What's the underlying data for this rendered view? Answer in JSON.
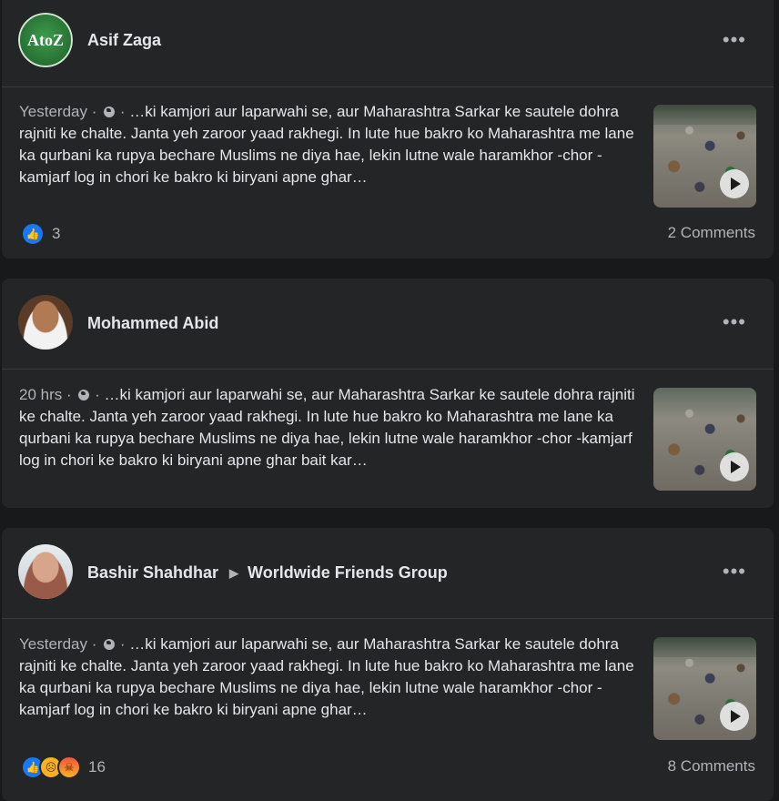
{
  "posts": [
    {
      "author": "Asif Zaga",
      "group": "",
      "avatar_text": "AtoZ",
      "time": "Yesterday",
      "text": "…ki kamjori aur laparwahi se, aur Maharashtra Sarkar ke sautele dohra rajniti ke chalte. Janta yeh zaroor yaad rakhegi. In lute hue bakro ko Maharashtra me lane ka qurbani ka rupya bechare Muslims ne diya hae, lekin lutne wale haramkhor -chor -kamjarf log in chori ke bakro ki biryani apne ghar…",
      "reactions": [
        "like"
      ],
      "reaction_count": "3",
      "comments": "2 Comments"
    },
    {
      "author": "Mohammed Abid",
      "group": "",
      "time": "20 hrs",
      "text": "…ki kamjori aur laparwahi se, aur Maharashtra Sarkar ke sautele dohra rajniti ke chalte. Janta yeh zaroor yaad rakhegi. In lute hue bakro ko Maharashtra me lane ka qurbani ka rupya bechare Muslims ne diya hae, lekin lutne wale haramkhor -chor -kamjarf log in chori ke bakro ki biryani apne ghar bait kar…",
      "reactions": [],
      "reaction_count": "",
      "comments": ""
    },
    {
      "author": "Bashir Shahdhar",
      "group": "Worldwide Friends Group",
      "time": "Yesterday",
      "text": "…ki kamjori aur laparwahi se, aur Maharashtra Sarkar ke sautele dohra rajniti ke chalte. Janta yeh zaroor yaad rakhegi. In lute hue bakro ko Maharashtra me lane ka qurbani ka rupya bechare Muslims ne diya hae, lekin lutne wale haramkhor -chor -kamjarf log in chori ke bakro ki biryani apne ghar…",
      "reactions": [
        "like",
        "sad",
        "angry"
      ],
      "reaction_count": "16",
      "comments": "8 Comments"
    }
  ],
  "meta_separator": "·",
  "more_label": "•••",
  "group_arrow": "▶",
  "icons": {
    "like": "like-icon",
    "sad": "sad-icon",
    "angry": "angry-icon",
    "globe": "globe-icon",
    "play": "play-icon",
    "more": "more-options-icon"
  },
  "colors": {
    "background": "#18191a",
    "card": "#242526",
    "text": "#e4e6eb",
    "secondary": "#b0b3b8",
    "like_blue": "#1877f2"
  }
}
